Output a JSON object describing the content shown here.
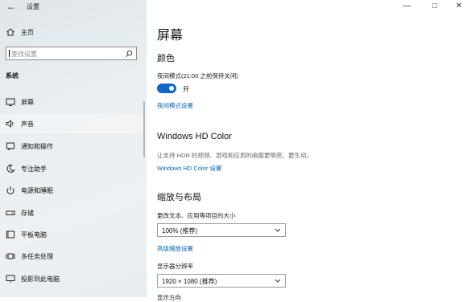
{
  "app": {
    "title": "设置",
    "back_label": "←"
  },
  "window_controls": {
    "minimize": "—",
    "maximize": "□",
    "close": "✕"
  },
  "sidebar": {
    "home_label": "主页",
    "search_placeholder": "查找设置",
    "section_title": "系统",
    "items": [
      {
        "label": "屏幕",
        "icon": "monitor-icon"
      },
      {
        "label": "声音",
        "icon": "speaker-icon"
      },
      {
        "label": "通知和操作",
        "icon": "notification-icon"
      },
      {
        "label": "专注助手",
        "icon": "moon-icon"
      },
      {
        "label": "电源和睡眠",
        "icon": "power-icon"
      },
      {
        "label": "存储",
        "icon": "storage-icon"
      },
      {
        "label": "平板电脑",
        "icon": "tablet-icon"
      },
      {
        "label": "多任务处理",
        "icon": "multitask-icon"
      },
      {
        "label": "投影到此电脑",
        "icon": "projector-icon"
      }
    ]
  },
  "main": {
    "page_title": "屏幕",
    "color": {
      "heading": "颜色",
      "night_mode_label": "夜间模式(21:00 之前保持关闭)",
      "toggle_state": "开",
      "night_mode_link": "夜间模式设置"
    },
    "hdr": {
      "heading": "Windows HD Color",
      "description": "让支持 HDR 的视频、游戏和应用的画面更明亮、更生动。",
      "link": "Windows HD Color 设置"
    },
    "layout": {
      "heading": "缩放与布局",
      "scale_label": "更改文本、应用等项目的大小",
      "scale_value": "100% (推荐)",
      "advanced_link": "高级缩放设置",
      "resolution_label": "显示器分辨率",
      "resolution_value": "1920 × 1080 (推荐)",
      "orientation_label_partial": "显示方向"
    }
  },
  "colors": {
    "accent": "#1168c8",
    "link": "#0b61b5"
  }
}
